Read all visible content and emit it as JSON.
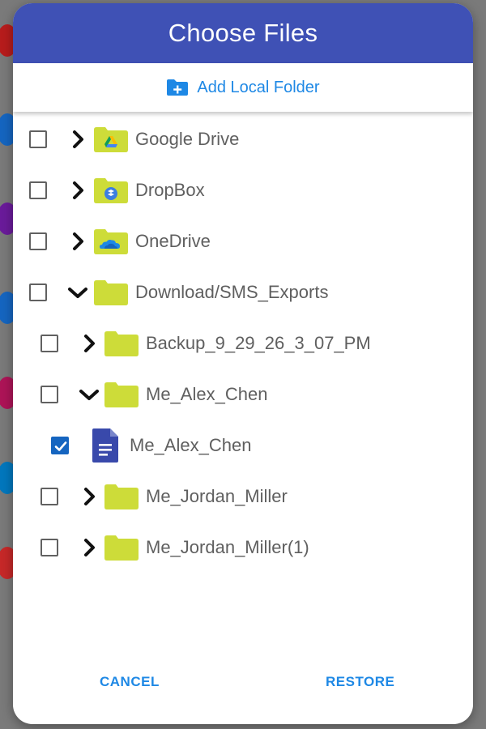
{
  "dialog": {
    "title": "Choose Files",
    "add_local_folder_label": "Add Local Folder",
    "cancel_label": "CANCEL",
    "restore_label": "RESTORE"
  },
  "colors": {
    "header": "#3f51b5",
    "accent": "#1e88e5",
    "folder": "#cddc39",
    "checkbox_checked": "#1565c0",
    "doc": "#3949ab"
  },
  "tree": [
    {
      "label": "Google Drive",
      "depth": 0,
      "expander": "collapsed",
      "icon": "google-drive-folder-icon",
      "checked": false
    },
    {
      "label": "DropBox",
      "depth": 0,
      "expander": "collapsed",
      "icon": "dropbox-folder-icon",
      "checked": false
    },
    {
      "label": "OneDrive",
      "depth": 0,
      "expander": "collapsed",
      "icon": "onedrive-folder-icon",
      "checked": false
    },
    {
      "label": "Download/SMS_Exports",
      "depth": 0,
      "expander": "expanded",
      "icon": "folder-icon",
      "checked": false
    },
    {
      "label": "Backup_9_29_26_3_07_PM",
      "depth": 1,
      "expander": "collapsed",
      "icon": "folder-icon",
      "checked": false
    },
    {
      "label": "Me_Alex_Chen",
      "depth": 1,
      "expander": "expanded",
      "icon": "folder-icon",
      "checked": false
    },
    {
      "label": "Me_Alex_Chen",
      "depth": 2,
      "expander": "none",
      "icon": "document-icon",
      "checked": true
    },
    {
      "label": "Me_Jordan_Miller",
      "depth": 1,
      "expander": "collapsed",
      "icon": "folder-icon",
      "checked": false
    },
    {
      "label": "Me_Jordan_Miller(1)",
      "depth": 1,
      "expander": "collapsed",
      "icon": "folder-icon",
      "checked": false
    }
  ]
}
